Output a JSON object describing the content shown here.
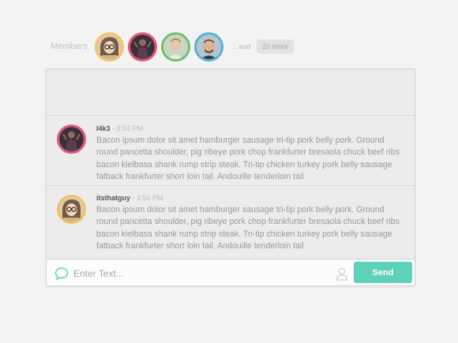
{
  "members": {
    "label": "Members",
    "avatars": [
      {
        "name": "member-avatar-1",
        "ring": "#f4c15d"
      },
      {
        "name": "member-avatar-2",
        "ring": "#e3567a"
      },
      {
        "name": "member-avatar-3",
        "ring": "#6fbe6a"
      },
      {
        "name": "member-avatar-4",
        "ring": "#4fb3d9"
      }
    ],
    "and_text": "... and",
    "more_badge": "20 more"
  },
  "messages": [
    {
      "author": "l4k3",
      "time": "- 3:54 PM",
      "ring": "#e3567a",
      "text": "Bacon ipsum dolor sit amet hamburger sausage tri-tip pork belly pork. Ground round pancetta shoulder, pig ribeye pork chop frankfurter bresaola chuck beef ribs bacon kielbasa shank rump strip steak. Tri-tip chicken turkey pork belly sausage fatback frankfurter short loin tail. Andouille tenderloin tail"
    },
    {
      "author": "itsthatguy",
      "time": "- 3:56 PM",
      "ring": "#f4c15d",
      "text": "Bacon ipsum dolor sit amet hamburger sausage tri-tip pork belly pork. Ground round pancetta shoulder, pig ribeye pork chop frankfurter bresaola chuck beef ribs bacon kielbasa shank rump strip steak. Tri-tip chicken turkey pork belly sausage fatback frankfurter short loin tail. Andouille tenderloin tail"
    }
  ],
  "composer": {
    "placeholder": "Enter Text...",
    "value": "",
    "send_label": "Send",
    "chat_icon": "speech-bubble-icon",
    "user_icon": "user-icon"
  },
  "colors": {
    "accent": "#5fd0b9",
    "page_background": "#f3f3f3"
  }
}
